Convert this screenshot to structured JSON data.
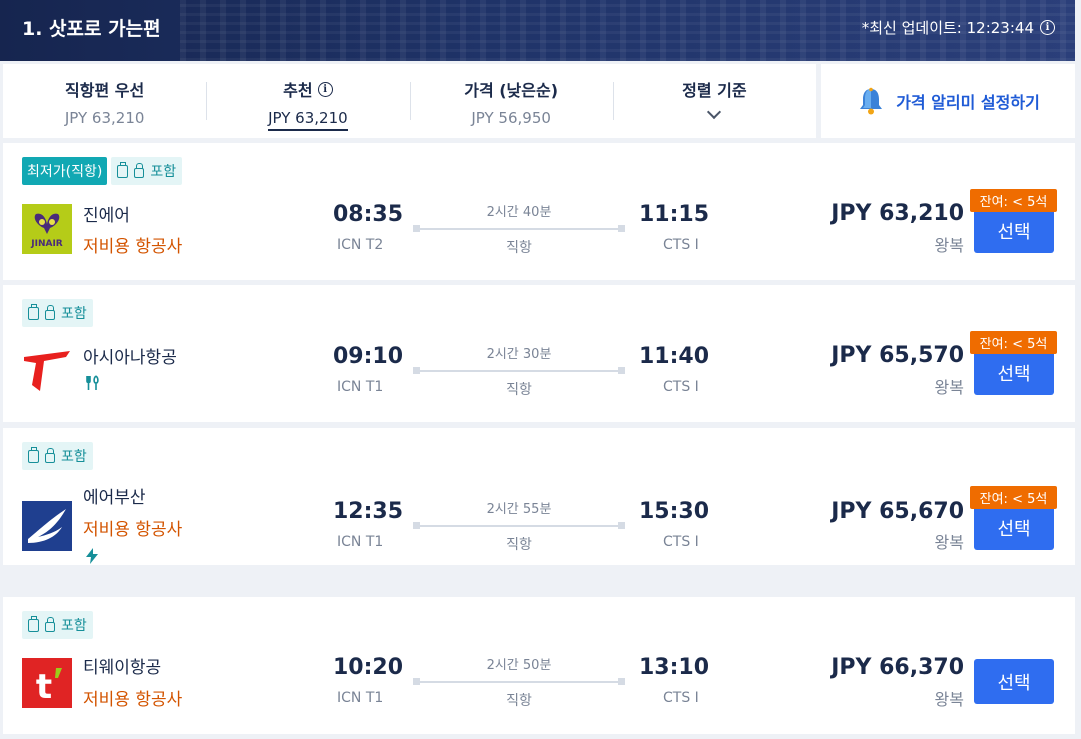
{
  "header": {
    "title": "1. 삿포로 가는편",
    "update_label": "*최신 업데이트: 12:23:44"
  },
  "sort_tabs": [
    {
      "label": "직항편 우선",
      "value": "JPY 63,210"
    },
    {
      "label": "추천",
      "value": "JPY 63,210"
    },
    {
      "label": "가격 (낮은순)",
      "value": "JPY 56,950"
    },
    {
      "label": "정렬 기준",
      "value": ""
    }
  ],
  "price_alert": {
    "label": "가격 알리미 설정하기"
  },
  "flights": [
    {
      "tag_lowest": "최저가(직항)",
      "tag_baggage": "포함",
      "airline": "진에어",
      "lcc_label": "저비용 항공사",
      "dep_time": "08:35",
      "dep_airport": "ICN T2",
      "duration": "2시간 40분",
      "direct": "직항",
      "arr_time": "11:15",
      "arr_airport": "CTS I",
      "price": "JPY 63,210",
      "trip": "왕복",
      "seats": "잔여: < 5석",
      "select": "선택"
    },
    {
      "tag_baggage": "포함",
      "airline": "아시아나항공",
      "dep_time": "09:10",
      "dep_airport": "ICN T1",
      "duration": "2시간 30분",
      "direct": "직항",
      "arr_time": "11:40",
      "arr_airport": "CTS I",
      "price": "JPY 65,570",
      "trip": "왕복",
      "seats": "잔여: < 5석",
      "select": "선택"
    },
    {
      "tag_baggage": "포함",
      "airline": "에어부산",
      "lcc_label": "저비용 항공사",
      "dep_time": "12:35",
      "dep_airport": "ICN T1",
      "duration": "2시간 55분",
      "direct": "직항",
      "arr_time": "15:30",
      "arr_airport": "CTS I",
      "price": "JPY 65,670",
      "trip": "왕복",
      "seats": "잔여: < 5석",
      "select": "선택"
    },
    {
      "tag_baggage": "포함",
      "airline": "티웨이항공",
      "lcc_label": "저비용 항공사",
      "dep_time": "10:20",
      "dep_airport": "ICN T1",
      "duration": "2시간 50분",
      "direct": "직항",
      "arr_time": "13:10",
      "arr_airport": "CTS I",
      "price": "JPY 66,370",
      "trip": "왕복",
      "select": "선택"
    }
  ],
  "logos": {
    "jinair_text": "JINAIR",
    "tway_text": "t"
  },
  "colors": {
    "brand_blue": "#2f6df0",
    "seat_orange": "#ef6c00",
    "tag_teal": "#11a8b3",
    "lcc_orange": "#d35400"
  }
}
